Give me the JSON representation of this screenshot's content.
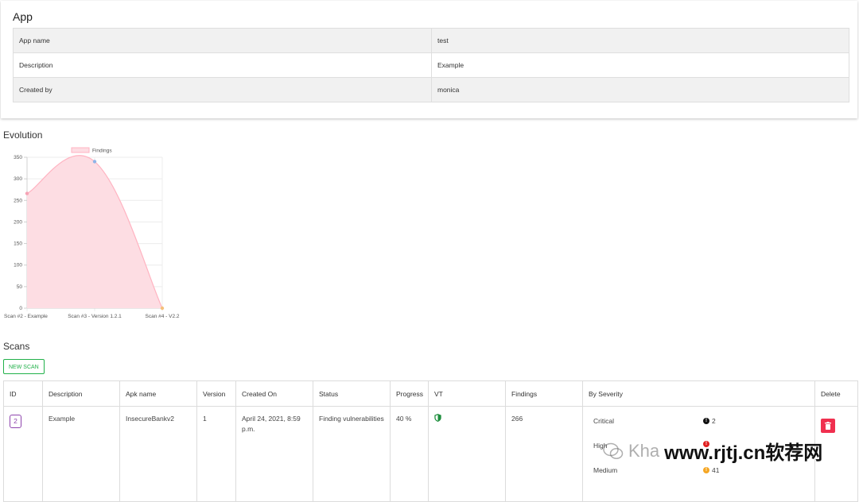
{
  "app": {
    "title": "App",
    "rows": [
      {
        "key": "App name",
        "value": "test"
      },
      {
        "key": "Description",
        "value": "Example"
      },
      {
        "key": "Created by",
        "value": "monica"
      }
    ]
  },
  "evolution": {
    "title": "Evolution"
  },
  "chart_data": {
    "type": "area",
    "legend": [
      "Findings"
    ],
    "categories": [
      "Scan #2 - Example",
      "Scan #3 - Version 1.2.1",
      "Scan #4 - V2.2"
    ],
    "series": [
      {
        "name": "Findings",
        "values": [
          266,
          340,
          0
        ]
      }
    ],
    "yticks": [
      0,
      50,
      100,
      150,
      200,
      250,
      300,
      350
    ],
    "ylim": [
      0,
      350
    ],
    "legend_position": "top",
    "colors": {
      "fill": "#fddde3",
      "line": "#ffb3c1"
    }
  },
  "scans": {
    "title": "Scans",
    "new_scan_label": "NEW SCAN",
    "columns": [
      "ID",
      "Description",
      "Apk name",
      "Version",
      "Created On",
      "Status",
      "Progress",
      "VT",
      "Findings",
      "By Severity",
      "Delete"
    ],
    "row": {
      "id": "2",
      "description": "Example",
      "apk_name": "InsecureBankv2",
      "version": "1",
      "created_on": "April 24, 2021, 8:59 p.m.",
      "status": "Finding vulnerabilities",
      "progress": "40 %",
      "findings": "266",
      "severity": [
        {
          "label": "Critical",
          "count": "2",
          "color": "#111111"
        },
        {
          "label": "High",
          "count": "",
          "color": "#e02020"
        },
        {
          "label": "Medium",
          "count": "41",
          "color": "#f5a623"
        }
      ]
    }
  },
  "watermark": {
    "text": "Kha",
    "brand": "www.rjtj.cn软荐网"
  }
}
